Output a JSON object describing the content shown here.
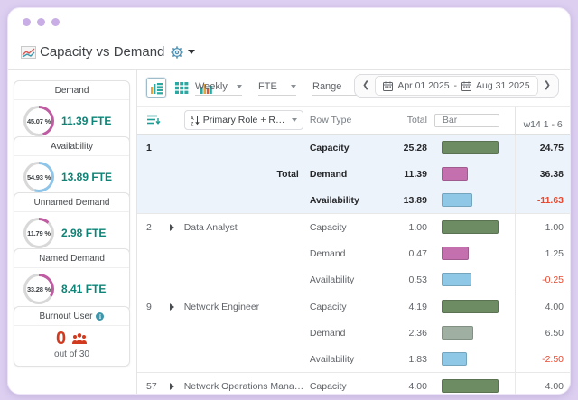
{
  "window": {
    "title": "Capacity vs Demand"
  },
  "colors": {
    "accent_teal": "#0d8477",
    "donut_track": "#d8d8d8",
    "negative_red": "#e8492f",
    "burnout_red": "#d13a1e",
    "highlight_row_bg": "#edf3fa",
    "frame_lavender": "#dccff0",
    "bars": {
      "green": "#6e8c63",
      "pink": "#c46fae",
      "blue": "#8fc8e7",
      "sage": "#9fb0a2"
    }
  },
  "sidebar": {
    "cards": [
      {
        "title": "Demand",
        "pct_label": "45.07 %",
        "pct": 45.07,
        "fte": "11.39 FTE",
        "donut_color": "#bf5ca2"
      },
      {
        "title": "Availability",
        "pct_label": "54.93 %",
        "pct": 54.93,
        "fte": "13.89 FTE",
        "donut_color": "#8fc5e8"
      },
      {
        "title": "Unnamed Demand",
        "pct_label": "11.79 %",
        "pct": 11.79,
        "fte": "2.98 FTE",
        "donut_color": "#bf5ca2"
      },
      {
        "title": "Named Demand",
        "pct_label": "33.28 %",
        "pct": 33.28,
        "fte": "8.41 FTE",
        "donut_color": "#bf5ca2"
      }
    ],
    "burnout": {
      "title": "Burnout User",
      "count": "0",
      "caption": "out of 30"
    }
  },
  "toolbar": {
    "dropdowns": [
      {
        "label": "Weekly"
      },
      {
        "label": "FTE"
      },
      {
        "label": "Range"
      }
    ],
    "date_range": {
      "start": "Apr 01 2025",
      "separator": "-",
      "end": "Aug 31 2025"
    }
  },
  "table": {
    "header": {
      "group_by": "Primary Role + Resource...",
      "row_type": "Row Type",
      "total": "Total",
      "bar": "Bar",
      "period": "w14 1 - 6"
    },
    "groups": [
      {
        "num": "1",
        "name": "",
        "label": "Total",
        "caret": false,
        "highlight": true,
        "bold": true,
        "rows": [
          {
            "type": "Capacity",
            "total": "25.28",
            "w14": "24.75",
            "bar_pct": 100,
            "bar_color": "green",
            "dotted": false
          },
          {
            "type": "Demand",
            "total": "11.39",
            "w14": "36.38",
            "bar_pct": 46,
            "bar_color": "pink",
            "dotted": true
          },
          {
            "type": "Availability",
            "total": "13.89",
            "w14": "-11.63",
            "bar_pct": 54,
            "bar_color": "blue",
            "dotted": false
          }
        ]
      },
      {
        "num": "2",
        "name": "Data Analyst",
        "label": "",
        "caret": true,
        "highlight": false,
        "bold": false,
        "rows": [
          {
            "type": "Capacity",
            "total": "1.00",
            "w14": "1.00",
            "bar_pct": 100,
            "bar_color": "green",
            "dotted": false
          },
          {
            "type": "Demand",
            "total": "0.47",
            "w14": "1.25",
            "bar_pct": 47,
            "bar_color": "pink",
            "dotted": true
          },
          {
            "type": "Availability",
            "total": "0.53",
            "w14": "-0.25",
            "bar_pct": 53,
            "bar_color": "blue",
            "dotted": false
          }
        ]
      },
      {
        "num": "9",
        "name": "Network Engineer",
        "label": "",
        "caret": true,
        "highlight": false,
        "bold": false,
        "rows": [
          {
            "type": "Capacity",
            "total": "4.19",
            "w14": "4.00",
            "bar_pct": 100,
            "bar_color": "green",
            "dotted": false
          },
          {
            "type": "Demand",
            "total": "2.36",
            "w14": "6.50",
            "bar_pct": 56,
            "bar_color": "sage",
            "dotted": true
          },
          {
            "type": "Availability",
            "total": "1.83",
            "w14": "-2.50",
            "bar_pct": 44,
            "bar_color": "blue",
            "dotted": false
          }
        ]
      },
      {
        "num": "57",
        "name": "Network Operations Manager",
        "label": "",
        "caret": true,
        "highlight": false,
        "bold": false,
        "rows": [
          {
            "type": "Capacity",
            "total": "4.00",
            "w14": "4.00",
            "bar_pct": 100,
            "bar_color": "green",
            "dotted": false
          }
        ]
      }
    ]
  }
}
